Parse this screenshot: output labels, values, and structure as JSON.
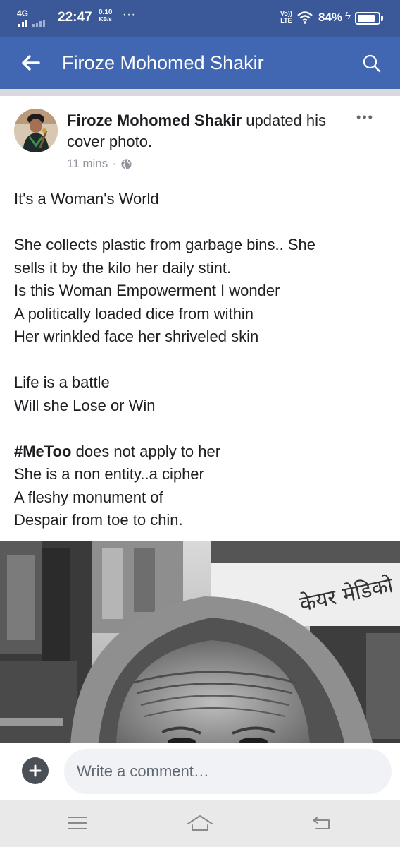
{
  "status_bar": {
    "network": "4G",
    "time": "22:47",
    "speed_value": "0.10",
    "speed_unit": "KB/s",
    "volte_top": "Vo))",
    "volte_bottom": "LTE",
    "battery_percent": "84%",
    "battery_level": 0.84,
    "icons": [
      "signal-icon",
      "wifi-icon",
      "charging-icon",
      "battery-icon"
    ]
  },
  "app_bar": {
    "title": "Firoze Mohomed Shakir",
    "back_icon": "arrow-left-icon",
    "search_icon": "search-icon",
    "color": "#4267b2"
  },
  "post": {
    "author": "Firoze Mohomed Shakir",
    "action": " updated his cover photo.",
    "time": "11 mins",
    "separator": "·",
    "privacy_icon": "globe-icon",
    "more_icon": "more-icon",
    "more_label": "•••",
    "text": {
      "title": "It's a Woman's World",
      "s1_l1": "She collects plastic from garbage bins.. She",
      "s1_l2": "sells it by the kilo her daily stint.",
      "s1_l3": "Is this Woman Empowerment I wonder",
      "s1_l4": "A politically loaded dice from within",
      "s1_l5": "Her wrinkled face her shriveled skin",
      "s2_l1": "Life is a battle",
      "s2_l2": "Will she Lose or Win",
      "s3_hashtag": "#MeToo",
      "s3_l1_rest": " does not apply to her",
      "s3_l2": "She is a non entity..a cipher",
      "s3_l3": "A fleshy monument of",
      "s3_l4": "Despair from toe to chin."
    },
    "cover_photo": {
      "shop_sign": "केयर मेडिको"
    }
  },
  "comment": {
    "placeholder": "Write a comment…",
    "add_icon": "plus-icon"
  },
  "nav_bar": {
    "icons": [
      "menu-icon",
      "home-icon",
      "back-icon"
    ]
  }
}
